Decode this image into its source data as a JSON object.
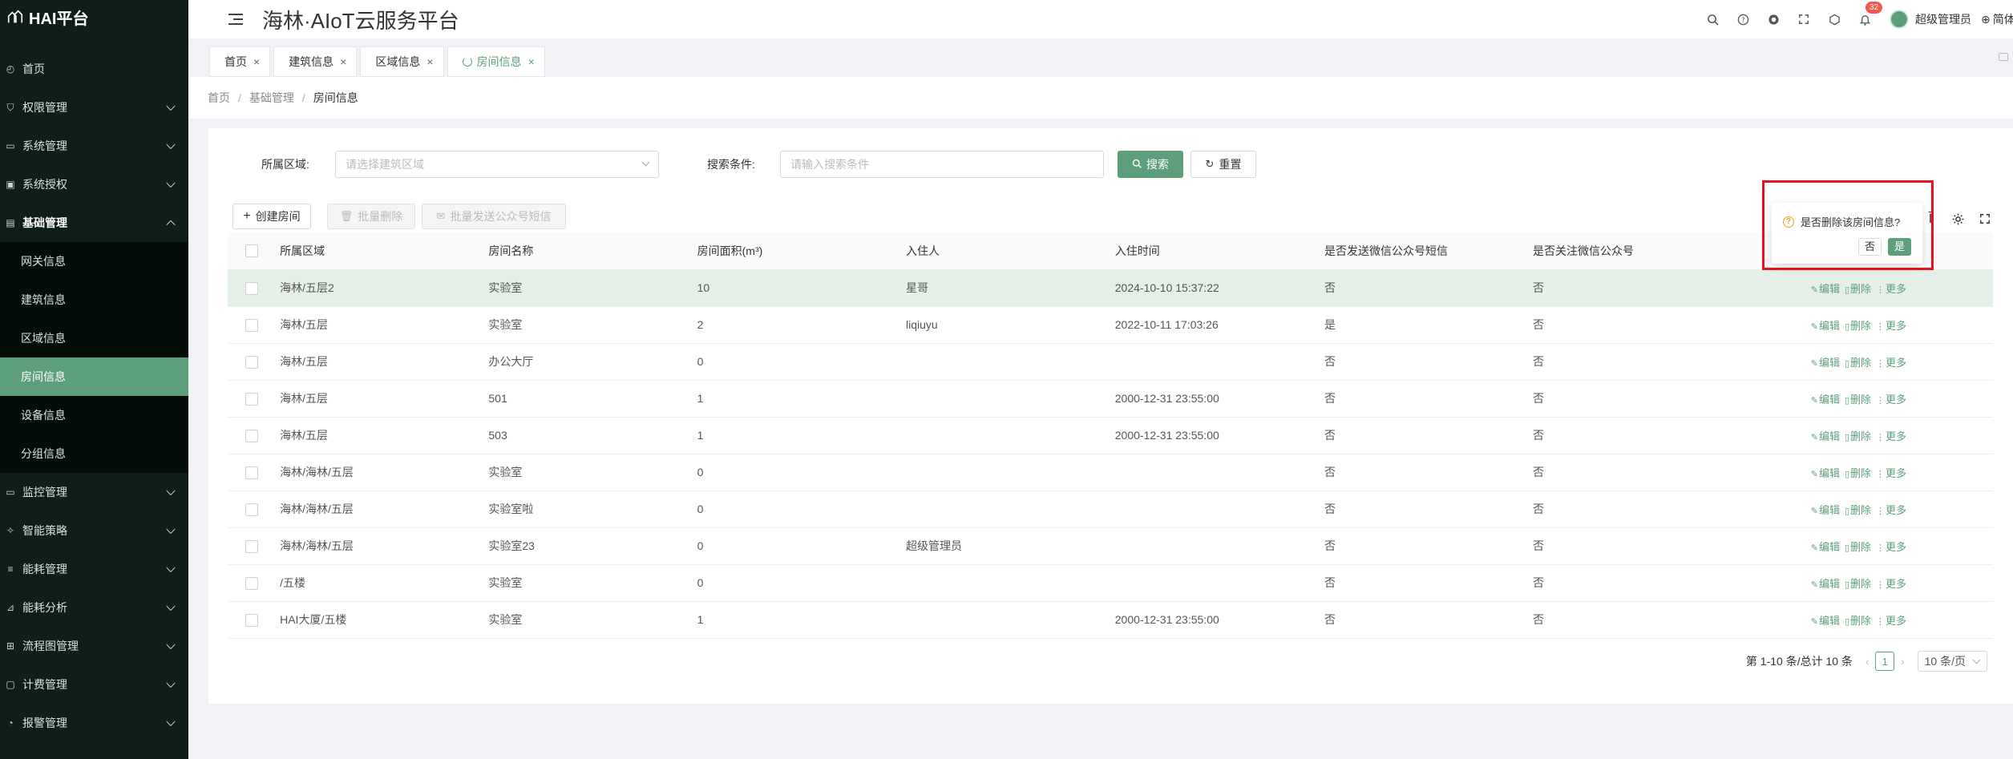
{
  "app": {
    "logo_text": "HAI平台",
    "title": "海林·AIoT云服务平台"
  },
  "header": {
    "notification_count": "32",
    "username": "超级管理员",
    "language": "简体中文"
  },
  "sidebar": {
    "items": [
      {
        "label": "首页",
        "icon": "home-icon"
      },
      {
        "label": "权限管理",
        "icon": "shield-icon"
      },
      {
        "label": "系统管理",
        "icon": "monitor-icon"
      },
      {
        "label": "系统授权",
        "icon": "key-icon"
      },
      {
        "label": "基础管理",
        "icon": "database-icon"
      }
    ],
    "sub_items": [
      {
        "label": "网关信息"
      },
      {
        "label": "建筑信息"
      },
      {
        "label": "区域信息"
      },
      {
        "label": "房间信息"
      },
      {
        "label": "设备信息"
      },
      {
        "label": "分组信息"
      }
    ],
    "after_items": [
      {
        "label": "监控管理"
      },
      {
        "label": "智能策略"
      },
      {
        "label": "能耗管理"
      },
      {
        "label": "能耗分析"
      },
      {
        "label": "流程图管理"
      },
      {
        "label": "计费管理"
      },
      {
        "label": "报警管理"
      }
    ]
  },
  "tabs": [
    {
      "label": "首页"
    },
    {
      "label": "建筑信息"
    },
    {
      "label": "区域信息"
    },
    {
      "label": "房间信息"
    }
  ],
  "breadcrumb": {
    "l1": "首页",
    "l2": "基础管理",
    "l3": "房间信息"
  },
  "search": {
    "area_label": "所属区域:",
    "area_placeholder": "请选择建筑区域",
    "cond_label": "搜索条件:",
    "cond_placeholder": "请输入搜索条件",
    "search_btn": "搜索",
    "reset_btn": "重置"
  },
  "toolbar": {
    "create": "创建房间",
    "batch_delete": "批量删除",
    "batch_sms": "批量发送公众号短信"
  },
  "table": {
    "columns": [
      "所属区域",
      "房间名称",
      "房间面积(m³)",
      "入住人",
      "入住时间",
      "是否发送微信公众号短信",
      "是否关注微信公众号"
    ],
    "action_labels": {
      "edit": "编辑",
      "delete": "删除",
      "more": "更多"
    },
    "rows": [
      [
        "海林/五层2",
        "实验室",
        "10",
        "星哥",
        "2024-10-10 15:37:22",
        "否",
        "否"
      ],
      [
        "海林/五层",
        "实验室",
        "2",
        "liqiuyu",
        "2022-10-11 17:03:26",
        "是",
        "否"
      ],
      [
        "海林/五层",
        "办公大厅",
        "0",
        "",
        "",
        "否",
        "否"
      ],
      [
        "海林/五层",
        "501",
        "1",
        "",
        "2000-12-31 23:55:00",
        "否",
        "否"
      ],
      [
        "海林/五层",
        "503",
        "1",
        "",
        "2000-12-31 23:55:00",
        "否",
        "否"
      ],
      [
        "海林/海林/五层",
        "实验室",
        "0",
        "",
        "",
        "否",
        "否"
      ],
      [
        "海林/海林/五层",
        "实验室啦",
        "0",
        "",
        "",
        "否",
        "否"
      ],
      [
        "海林/海林/五层",
        "实验室23",
        "0",
        "超级管理员",
        "",
        "否",
        "否"
      ],
      [
        "/五楼",
        "实验室",
        "0",
        "",
        "",
        "否",
        "否"
      ],
      [
        "HAI大厦/五楼",
        "实验室",
        "1",
        "",
        "2000-12-31 23:55:00",
        "否",
        "否"
      ]
    ]
  },
  "pagination": {
    "summary": "第 1-10 条/总计 10 条",
    "current": "1",
    "page_size": "10 条/页"
  },
  "popconfirm": {
    "question": "是否删除该房间信息?",
    "no": "否",
    "yes": "是"
  },
  "colors": {
    "primary": "#5e9f7b",
    "sidebar_bg": "#0f1f18",
    "highlight": "#e8101a"
  }
}
